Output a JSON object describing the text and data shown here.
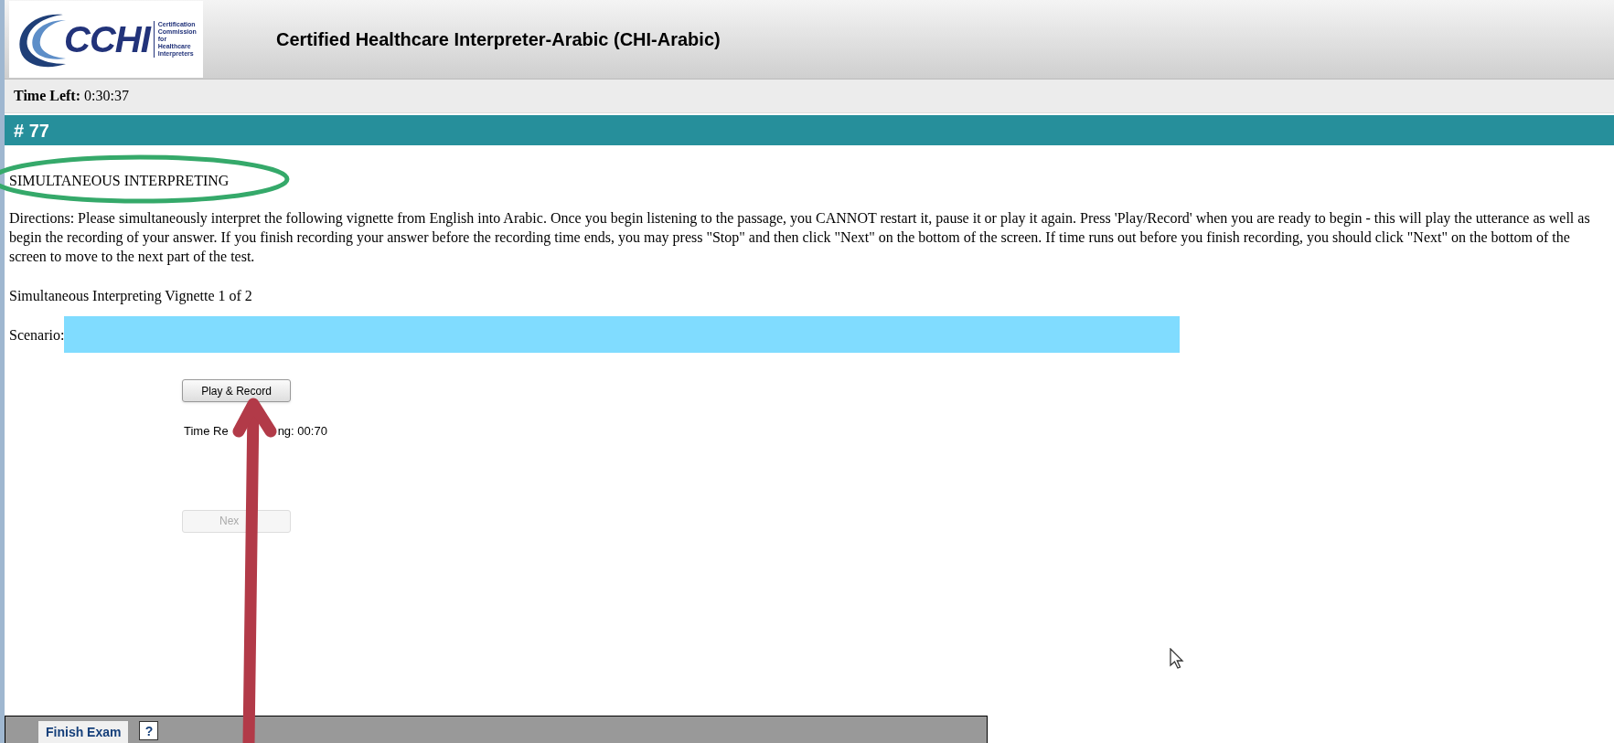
{
  "header": {
    "logo_text": "CCHI",
    "logo_subtitle": [
      "Certification",
      "Commission for",
      "Healthcare",
      "Interpreters"
    ],
    "title": "Certified Healthcare Interpreter-Arabic (CHI-Arabic)"
  },
  "timer": {
    "label": "Time Left:",
    "value": "0:30:37"
  },
  "question_number": "# 77",
  "section_title": "SIMULTANEOUS INTERPRETING",
  "directions": "Directions: Please simultaneously interpret the following vignette from English into Arabic. Once you begin listening to the passage, you CANNOT restart it, pause it or play it again. Press 'Play/Record' when you are ready to begin - this will play the utterance as well as begin the recording of your answer. If you finish recording your answer before the recording time ends, you may press \"Stop\" and then click \"Next\" on the bottom of the screen. If time runs out before you finish recording, you should click \"Next\" on the bottom of the screen to move to the next part of the test.",
  "vignette_label": "Simultaneous Interpreting Vignette 1 of 2",
  "scenario_label": "Scenario:",
  "play_button": {
    "label": "Play & Record",
    "disabled": false
  },
  "time_remaining": [
    "Time Re",
    "ng: 00:70"
  ],
  "next_button": {
    "label": "Nex",
    "disabled": true
  },
  "footer": {
    "finish_button": "Finish Exam",
    "help_button": "?"
  }
}
